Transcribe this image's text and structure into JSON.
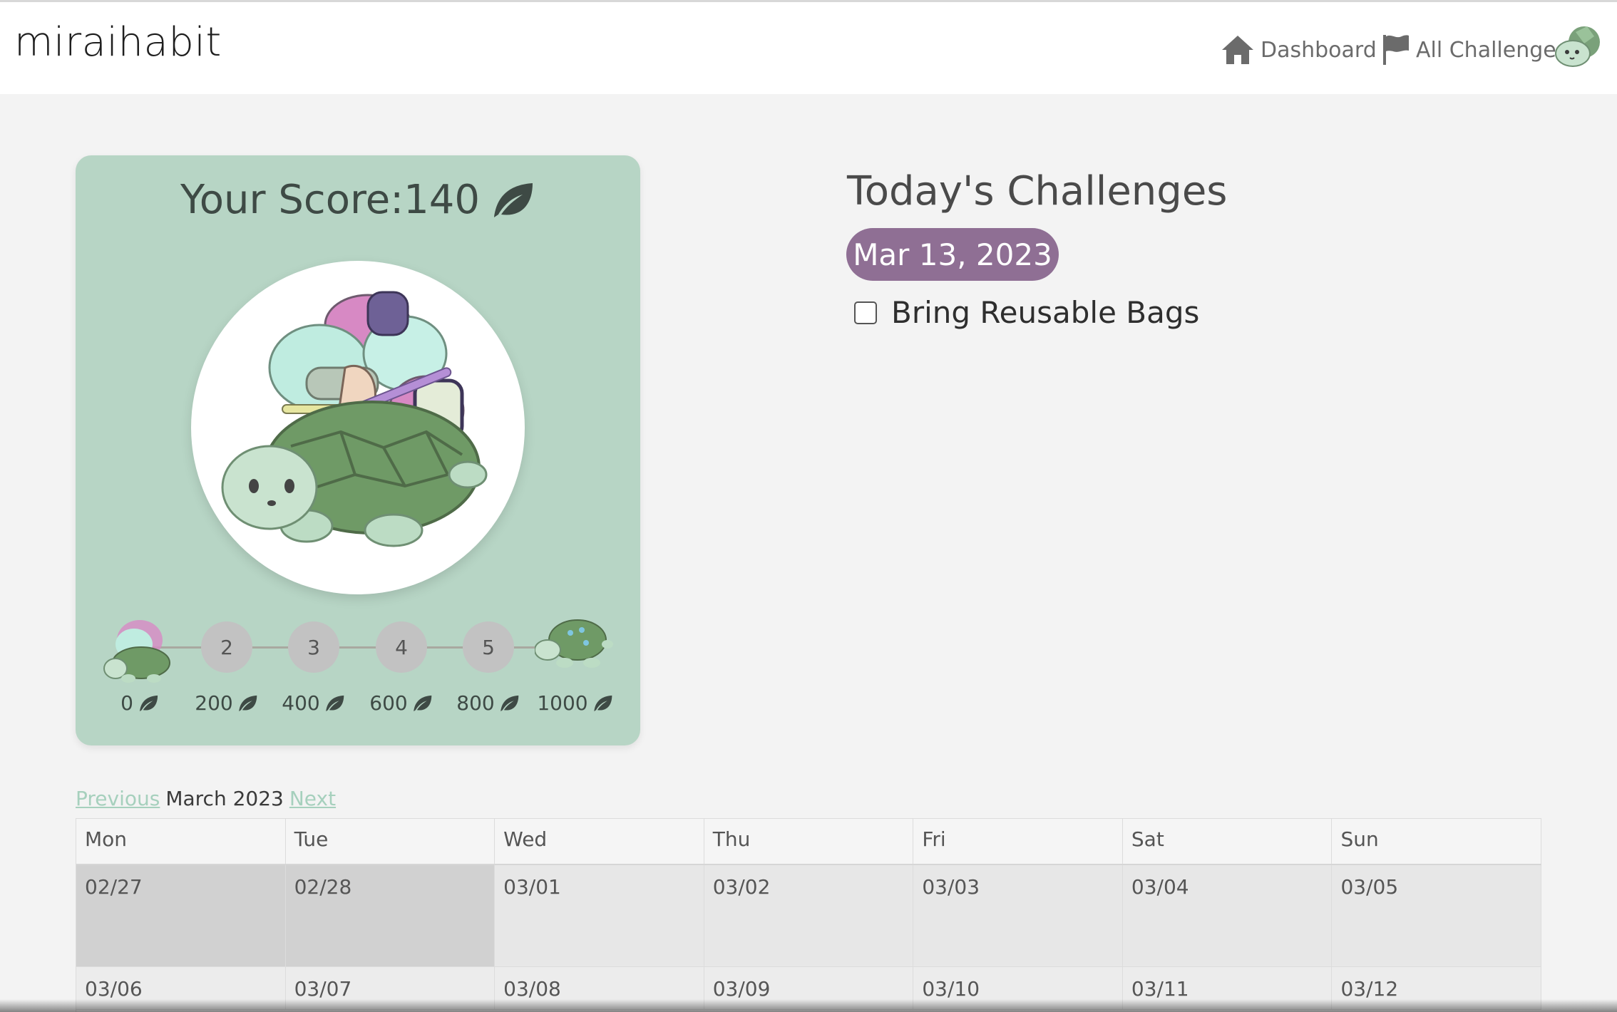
{
  "header": {
    "brand": "miraihabit",
    "nav": [
      {
        "label": "Dashboard",
        "icon": "home-icon"
      },
      {
        "label": "All Challenges",
        "icon": "flag-icon"
      }
    ],
    "avatar_icon": "turtle-avatar-icon"
  },
  "score": {
    "label": "Your Score:",
    "value": "140",
    "icon": "leaf-icon",
    "levels": [
      "2",
      "3",
      "4",
      "5"
    ],
    "milestones": [
      "0",
      "200",
      "400",
      "600",
      "800",
      "1000"
    ]
  },
  "challenges": {
    "title": "Today's Challenges",
    "date": "Mar 13, 2023",
    "items": [
      {
        "label": "Bring Reusable Bags",
        "checked": false
      }
    ]
  },
  "calendar": {
    "prev_label": "Previous",
    "month_label": "March 2023",
    "next_label": "Next",
    "days": [
      "Mon",
      "Tue",
      "Wed",
      "Thu",
      "Fri",
      "Sat",
      "Sun"
    ],
    "week1": [
      "02/27",
      "02/28",
      "03/01",
      "03/02",
      "03/03",
      "03/04",
      "03/05"
    ],
    "week2": [
      "03/06",
      "03/07",
      "03/08",
      "03/09",
      "03/10",
      "03/11",
      "03/12"
    ]
  },
  "colors": {
    "card_bg": "#b7d5c5",
    "date_pill": "#8f6f94",
    "link_green": "#a6d0bd",
    "page_bg": "#f3f3f3"
  }
}
